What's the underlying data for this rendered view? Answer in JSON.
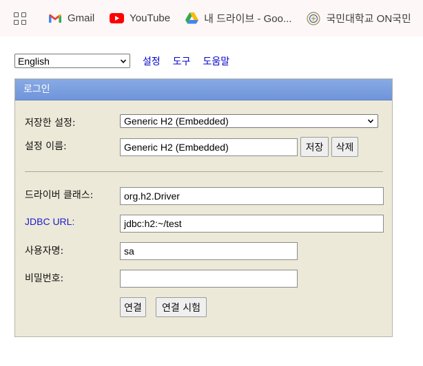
{
  "bookmarks": [
    {
      "icon": "gmail-icon",
      "label": "Gmail"
    },
    {
      "icon": "youtube-icon",
      "label": "YouTube"
    },
    {
      "icon": "google-drive-icon",
      "label": "내 드라이브 - Goo..."
    },
    {
      "icon": "kookmin-university-icon",
      "label": "국민대학교 ON국민"
    }
  ],
  "top": {
    "language": "English",
    "links": [
      "설정",
      "도구",
      "도움말"
    ]
  },
  "login": {
    "title": "로그인",
    "saved_settings_label": "저장한 설정:",
    "saved_settings_value": "Generic H2 (Embedded)",
    "setting_name_label": "설정 이름:",
    "setting_name_value": "Generic H2 (Embedded)",
    "save_button": "저장",
    "delete_button": "삭제",
    "driver_class_label": "드라이버 클래스:",
    "driver_class_value": "org.h2.Driver",
    "jdbc_url_label": "JDBC URL:",
    "jdbc_url_value": "jdbc:h2:~/test",
    "username_label": "사용자명:",
    "username_value": "sa",
    "password_label": "비밀번호:",
    "password_value": "",
    "connect_button": "연결",
    "test_connection_button": "연결 시험"
  },
  "colors": {
    "panel_bg": "#ece9d8",
    "header_bg": "#7a9de0",
    "link": "#0000cc"
  }
}
